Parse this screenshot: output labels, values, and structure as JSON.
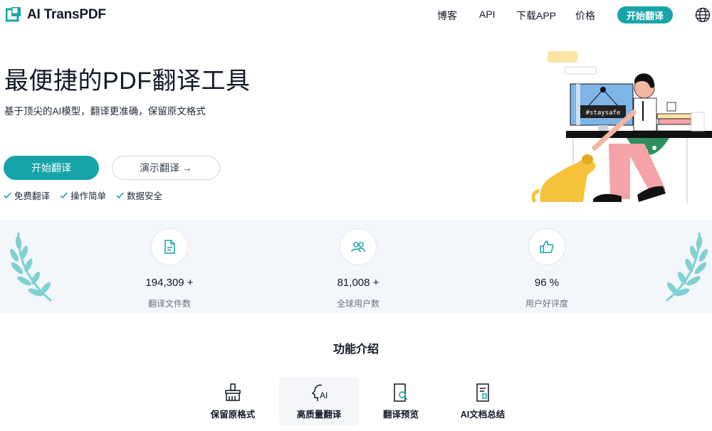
{
  "header": {
    "brand": "AI TransPDF",
    "nav": [
      "博客",
      "API",
      "下载APP",
      "价格"
    ],
    "start_button": "开始翻译"
  },
  "hero": {
    "title": "最便捷的PDF翻译工具",
    "subtitle": "基于顶尖的AI模型，翻译更准确，保留原文格式",
    "primary_button": "开始翻译",
    "demo_button": "演示翻译 →",
    "checks": [
      "免费翻译",
      "操作简单",
      "数据安全"
    ],
    "illustration_sign": "#staysafe"
  },
  "stats": [
    {
      "icon": "document-icon",
      "value": "194,309 +",
      "label": "翻译文件数"
    },
    {
      "icon": "users-icon",
      "value": "81,008 +",
      "label": "全球用户数"
    },
    {
      "icon": "thumbs-up-icon",
      "value": "96 %",
      "label": "用户好评度"
    }
  ],
  "features": {
    "title": "功能介绍",
    "tabs": [
      {
        "icon": "brush-icon",
        "label": "保留原格式"
      },
      {
        "icon": "ai-head-icon",
        "label": "高质量翻译",
        "active": true
      },
      {
        "icon": "preview-icon",
        "label": "翻译预览"
      },
      {
        "icon": "summary-doc-icon",
        "label": "AI文档总结"
      }
    ]
  },
  "colors": {
    "accent": "#16a4a8",
    "laurel": "#7fd0d5",
    "stats_bg": "#f3f6fa"
  }
}
